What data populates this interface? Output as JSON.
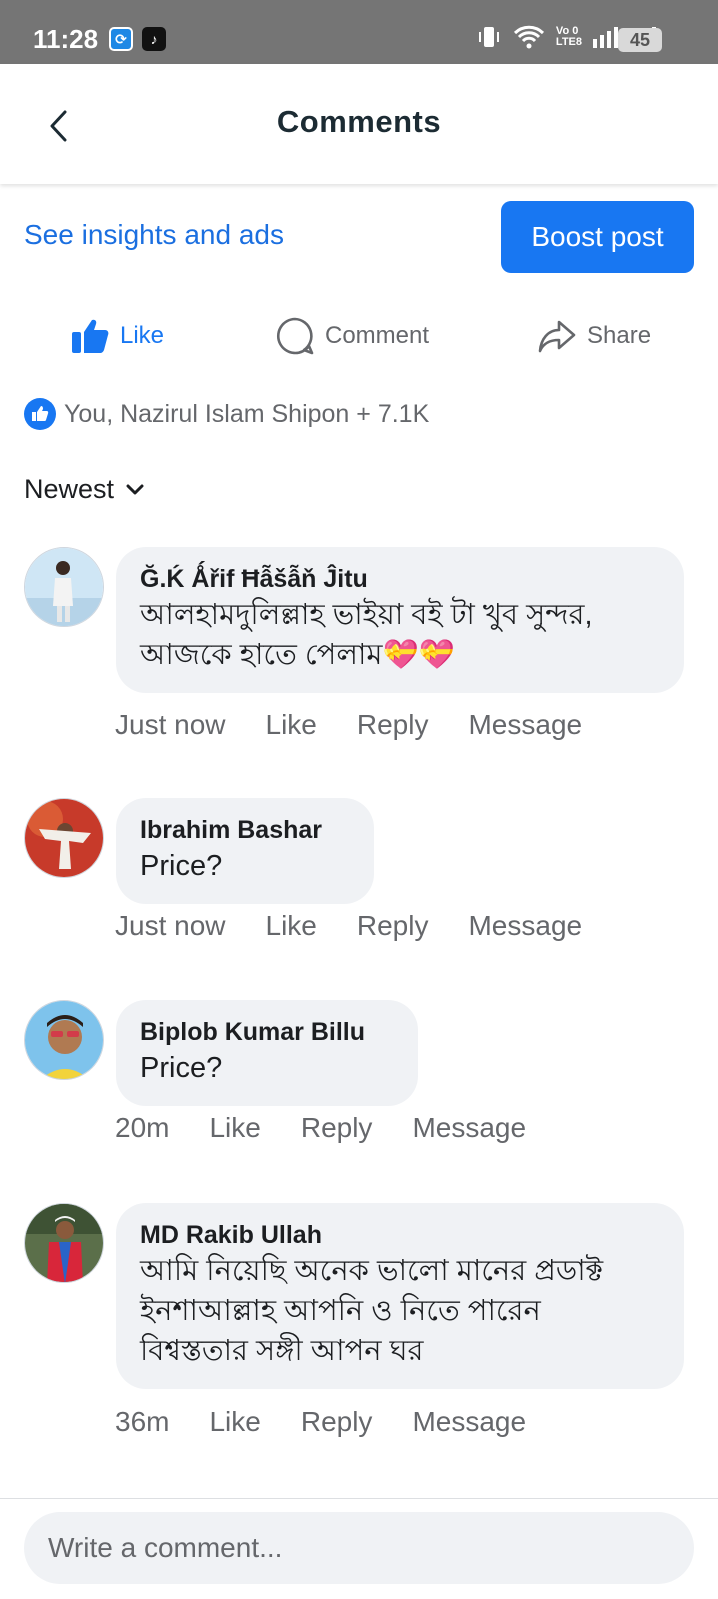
{
  "status_bar": {
    "time": "11:28",
    "network_label_top": "Vo 0",
    "network_label_bottom": "LTE8",
    "battery": "45"
  },
  "header": {
    "title": "Comments",
    "back_icon": "chevron-left-icon"
  },
  "insights": {
    "link_label": "See insights and ads",
    "boost_label": "Boost post"
  },
  "actions": {
    "like_label": "Like",
    "comment_label": "Comment",
    "share_label": "Share"
  },
  "reactions": {
    "text": "You, Nazirul Islam Shipon + 7.1K"
  },
  "sort": {
    "label": "Newest"
  },
  "comments": [
    {
      "name": "Ğ.Ḱ Ǻřif Ħẫšẫň Ĵitu",
      "lines": [
        "আলহামদুলিল্লাহ ভাইয়া বই টা খুব সুন্দর,",
        "আজকে হাতে পেলাম💝💝"
      ],
      "time": "Just now",
      "like": "Like",
      "reply": "Reply",
      "message": "Message"
    },
    {
      "name": "Ibrahim Bashar",
      "lines": [
        "Price?"
      ],
      "time": "Just now",
      "like": "Like",
      "reply": "Reply",
      "message": "Message"
    },
    {
      "name": "Biplob Kumar Billu",
      "lines": [
        "Price?"
      ],
      "time": "20m",
      "like": "Like",
      "reply": "Reply",
      "message": "Message"
    },
    {
      "name": "MD Rakib Ullah",
      "lines": [
        "আমি নিয়েছি অনেক ভালো মানের প্রডাক্ট",
        "ইনশাআল্লাহ আপনি ও নিতে পারেন",
        "বিশ্বস্ততার সঙ্গী আপন ঘর"
      ],
      "time": "36m",
      "like": "Like",
      "reply": "Reply",
      "message": "Message"
    }
  ],
  "composer": {
    "placeholder": "Write a comment..."
  },
  "colors": {
    "accent": "#1877f2",
    "bubble": "#f0f2f5",
    "muted_text": "#65676b"
  }
}
